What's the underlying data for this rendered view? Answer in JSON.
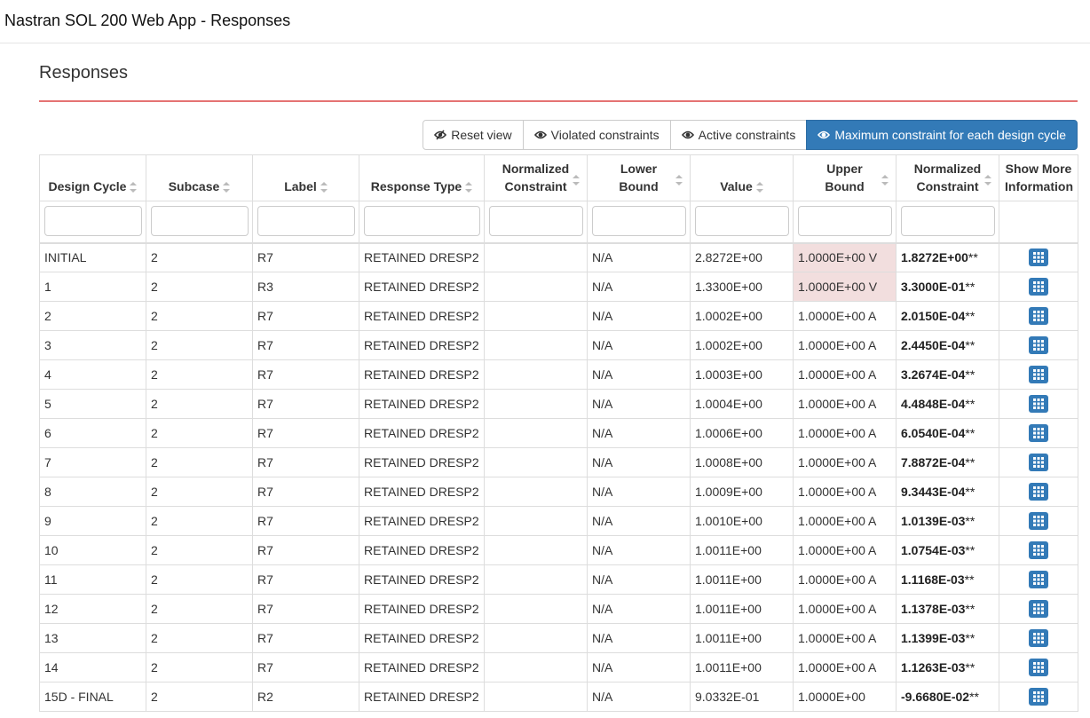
{
  "app": {
    "title": "Nastran SOL 200 Web App - Responses"
  },
  "page": {
    "title": "Responses"
  },
  "toolbar": {
    "reset_label": "Reset view",
    "violated_label": "Violated constraints",
    "active_label": "Active constraints",
    "max_label": "Maximum constraint for each design cycle",
    "active_button": "max",
    "accent_color": "#337ab7"
  },
  "table": {
    "headers": {
      "design_cycle": "Design Cycle",
      "subcase": "Subcase",
      "label": "Label",
      "response_type": "Response Type",
      "normalized_constraint_1": [
        "Normalized",
        "Constraint"
      ],
      "lower_bound": [
        "Lower",
        "Bound"
      ],
      "value": "Value",
      "upper_bound": [
        "Upper",
        "Bound"
      ],
      "normalized_constraint_2": [
        "Normalized",
        "Constraint"
      ],
      "show_more": [
        "Show More",
        "Information"
      ]
    },
    "violated_color": "#f2dede",
    "rows": [
      {
        "cycle": "INITIAL",
        "subcase": "2",
        "label": "R7",
        "type": "RETAINED DRESP2",
        "norm1": "",
        "lower": "N/A",
        "value": "2.8272E+00",
        "upper": "1.0000E+00 V",
        "norm2": "1.8272E+00",
        "stars": "**",
        "violated": true
      },
      {
        "cycle": "1",
        "subcase": "2",
        "label": "R3",
        "type": "RETAINED DRESP2",
        "norm1": "",
        "lower": "N/A",
        "value": "1.3300E+00",
        "upper": "1.0000E+00 V",
        "norm2": "3.3000E-01",
        "stars": "**",
        "violated": true
      },
      {
        "cycle": "2",
        "subcase": "2",
        "label": "R7",
        "type": "RETAINED DRESP2",
        "norm1": "",
        "lower": "N/A",
        "value": "1.0002E+00",
        "upper": "1.0000E+00 A",
        "norm2": "2.0150E-04",
        "stars": "**",
        "violated": false
      },
      {
        "cycle": "3",
        "subcase": "2",
        "label": "R7",
        "type": "RETAINED DRESP2",
        "norm1": "",
        "lower": "N/A",
        "value": "1.0002E+00",
        "upper": "1.0000E+00 A",
        "norm2": "2.4450E-04",
        "stars": "**",
        "violated": false
      },
      {
        "cycle": "4",
        "subcase": "2",
        "label": "R7",
        "type": "RETAINED DRESP2",
        "norm1": "",
        "lower": "N/A",
        "value": "1.0003E+00",
        "upper": "1.0000E+00 A",
        "norm2": "3.2674E-04",
        "stars": "**",
        "violated": false
      },
      {
        "cycle": "5",
        "subcase": "2",
        "label": "R7",
        "type": "RETAINED DRESP2",
        "norm1": "",
        "lower": "N/A",
        "value": "1.0004E+00",
        "upper": "1.0000E+00 A",
        "norm2": "4.4848E-04",
        "stars": "**",
        "violated": false
      },
      {
        "cycle": "6",
        "subcase": "2",
        "label": "R7",
        "type": "RETAINED DRESP2",
        "norm1": "",
        "lower": "N/A",
        "value": "1.0006E+00",
        "upper": "1.0000E+00 A",
        "norm2": "6.0540E-04",
        "stars": "**",
        "violated": false
      },
      {
        "cycle": "7",
        "subcase": "2",
        "label": "R7",
        "type": "RETAINED DRESP2",
        "norm1": "",
        "lower": "N/A",
        "value": "1.0008E+00",
        "upper": "1.0000E+00 A",
        "norm2": "7.8872E-04",
        "stars": "**",
        "violated": false
      },
      {
        "cycle": "8",
        "subcase": "2",
        "label": "R7",
        "type": "RETAINED DRESP2",
        "norm1": "",
        "lower": "N/A",
        "value": "1.0009E+00",
        "upper": "1.0000E+00 A",
        "norm2": "9.3443E-04",
        "stars": "**",
        "violated": false
      },
      {
        "cycle": "9",
        "subcase": "2",
        "label": "R7",
        "type": "RETAINED DRESP2",
        "norm1": "",
        "lower": "N/A",
        "value": "1.0010E+00",
        "upper": "1.0000E+00 A",
        "norm2": "1.0139E-03",
        "stars": "**",
        "violated": false
      },
      {
        "cycle": "10",
        "subcase": "2",
        "label": "R7",
        "type": "RETAINED DRESP2",
        "norm1": "",
        "lower": "N/A",
        "value": "1.0011E+00",
        "upper": "1.0000E+00 A",
        "norm2": "1.0754E-03",
        "stars": "**",
        "violated": false
      },
      {
        "cycle": "11",
        "subcase": "2",
        "label": "R7",
        "type": "RETAINED DRESP2",
        "norm1": "",
        "lower": "N/A",
        "value": "1.0011E+00",
        "upper": "1.0000E+00 A",
        "norm2": "1.1168E-03",
        "stars": "**",
        "violated": false
      },
      {
        "cycle": "12",
        "subcase": "2",
        "label": "R7",
        "type": "RETAINED DRESP2",
        "norm1": "",
        "lower": "N/A",
        "value": "1.0011E+00",
        "upper": "1.0000E+00 A",
        "norm2": "1.1378E-03",
        "stars": "**",
        "violated": false
      },
      {
        "cycle": "13",
        "subcase": "2",
        "label": "R7",
        "type": "RETAINED DRESP2",
        "norm1": "",
        "lower": "N/A",
        "value": "1.0011E+00",
        "upper": "1.0000E+00 A",
        "norm2": "1.1399E-03",
        "stars": "**",
        "violated": false
      },
      {
        "cycle": "14",
        "subcase": "2",
        "label": "R7",
        "type": "RETAINED DRESP2",
        "norm1": "",
        "lower": "N/A",
        "value": "1.0011E+00",
        "upper": "1.0000E+00 A",
        "norm2": "1.1263E-03",
        "stars": "**",
        "violated": false
      },
      {
        "cycle": "15D - FINAL",
        "subcase": "2",
        "label": "R2",
        "type": "RETAINED DRESP2",
        "norm1": "",
        "lower": "N/A",
        "value": "9.0332E-01",
        "upper": "1.0000E+00",
        "norm2": "-9.6680E-02",
        "stars": "**",
        "violated": false
      }
    ]
  }
}
